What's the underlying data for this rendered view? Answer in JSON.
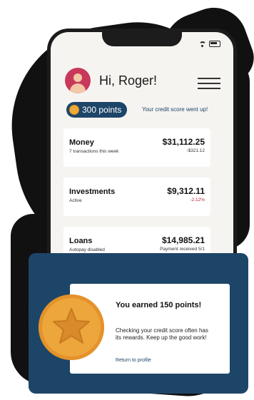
{
  "greeting": "Hi, Roger!",
  "points_badge": "300 points",
  "credit_message": "Your credit score went up!",
  "accounts": [
    {
      "title": "Money",
      "subtitle": "7 transactions this week",
      "amount": "$31,112.25",
      "delta": "-$321.12"
    },
    {
      "title": "Investments",
      "subtitle": "Active",
      "amount": "$9,312.11",
      "delta": "-2.12%"
    },
    {
      "title": "Loans",
      "subtitle": "Autopay disabled",
      "amount": "$14,985.21",
      "delta": "Payment received 5/1"
    }
  ],
  "reward": {
    "title": "You earned 150 points!",
    "text": "Checking your credit score often has its rewards. Keep up the good work!",
    "link": "Return to profile"
  },
  "colors": {
    "navy": "#1d4568",
    "coin": "#eda63c",
    "avatar": "#c8385a",
    "negative": "#c0243c"
  },
  "icons": [
    "wifi-icon",
    "battery-icon",
    "menu-icon",
    "coin-icon",
    "star-coin-icon"
  ]
}
